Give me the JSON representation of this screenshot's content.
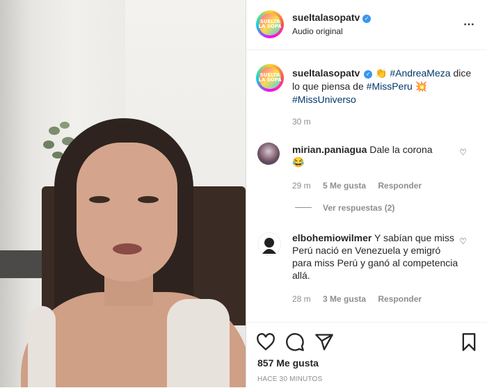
{
  "post": {
    "account": "sueltalasopatv",
    "audio_label": "Audio original",
    "avatar_text_line1": "SUELTA",
    "avatar_text_line2": "LA SOPA",
    "caption_user": "sueltalasopatv",
    "caption_hashtag1": "#AndreaMeza",
    "caption_text": "dice lo que piensa de",
    "caption_hashtag2": "#MissPeru",
    "caption_hashtag3": "#MissUniverso",
    "caption_time": "30 m",
    "likes": "857 Me gusta",
    "posted_ago": "HACE 30 MINUTOS"
  },
  "comments": [
    {
      "user": "mirian.paniagua",
      "text": "Dale la corona",
      "time": "29 m",
      "likes": "5 Me gusta",
      "reply": "Responder",
      "view_replies": "Ver respuestas (2)"
    },
    {
      "user": "elbohemiowilmer",
      "text": "Y sabían que miss Perú nació en Venezuela y emigró para miss Perú y ganó al competencia allá.",
      "time": "28 m",
      "likes": "3 Me gusta",
      "reply": "Responder"
    }
  ],
  "icons": {
    "more": "⋯",
    "heart": "heart-icon",
    "comment": "comment-icon",
    "share": "share-icon",
    "bookmark": "bookmark-icon"
  },
  "colors": {
    "hashtag": "#00376b",
    "verified": "#3897f0"
  }
}
